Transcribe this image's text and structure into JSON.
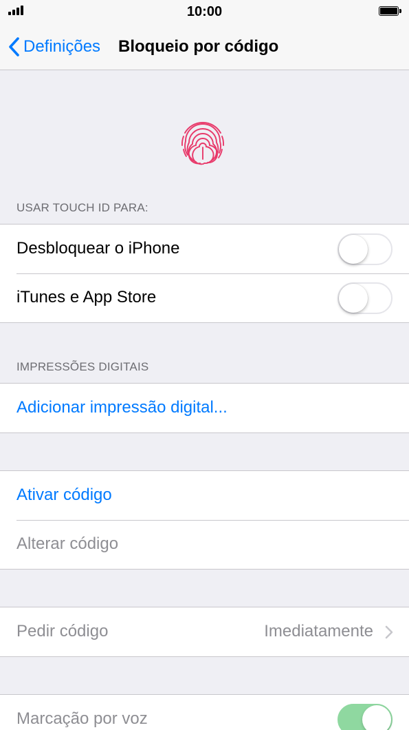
{
  "status_bar": {
    "time": "10:00",
    "signal_icon": "signal-bars-icon",
    "battery_icon": "battery-full-icon"
  },
  "nav": {
    "back_label": "Definições",
    "back_icon": "chevron-left-icon",
    "title": "Bloqueio por código"
  },
  "hero": {
    "icon": "fingerprint-icon",
    "color": "#e8396a"
  },
  "touch_id": {
    "header": "USAR TOUCH ID PARA:",
    "items": [
      {
        "label": "Desbloquear o iPhone",
        "enabled": false
      },
      {
        "label": "iTunes e App Store",
        "enabled": false
      }
    ]
  },
  "fingerprints": {
    "header": "IMPRESSÕES DIGITAIS",
    "add_label": "Adicionar impressão digital..."
  },
  "passcode": {
    "activate_label": "Ativar código",
    "change_label": "Alterar código"
  },
  "require": {
    "label": "Pedir código",
    "value": "Imediatamente"
  },
  "voice_dial": {
    "label": "Marcação por voz",
    "enabled": true
  },
  "colors": {
    "accent": "#007aff",
    "background": "#efeff4",
    "toggle_on": "#8fd8a0",
    "disabled_text": "#8e8e93"
  }
}
